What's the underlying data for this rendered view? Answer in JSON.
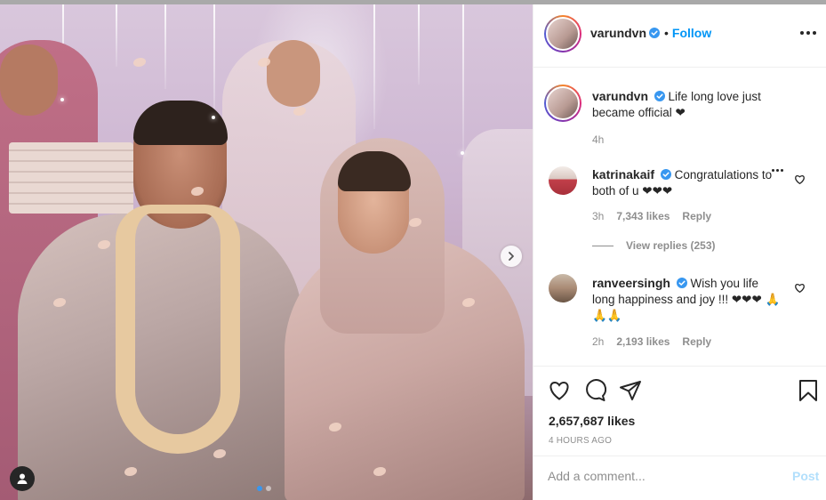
{
  "post": {
    "author": "varundvn",
    "follow_label": "Follow",
    "caption": "Life long love just became official ❤",
    "caption_time": "4h",
    "likes": "2,657,687 likes",
    "posted_ago": "4 HOURS AGO",
    "carousel": {
      "count": 2,
      "active": 1
    }
  },
  "comments": [
    {
      "user": "katrinakaif",
      "text": "Congratulations to both of u ❤❤❤",
      "time": "3h",
      "likes": "7,343 likes",
      "reply": "Reply",
      "view_replies": "View replies (253)"
    },
    {
      "user": "ranveersingh",
      "text": "Wish you life long happiness and joy !!! ❤❤❤ 🙏 🙏🙏",
      "time": "2h",
      "likes": "2,193 likes",
      "reply": "Reply"
    }
  ],
  "composer": {
    "placeholder": "Add a comment...",
    "post_label": "Post"
  },
  "colors": {
    "link_blue": "#0095f6",
    "verified_blue": "#3897f0",
    "muted": "#8e8e8e",
    "post_disabled": "#b2dffc"
  },
  "icons": [
    "more-icon",
    "verified-icon",
    "heart-icon",
    "comment-icon",
    "share-icon",
    "bookmark-icon",
    "next-arrow-icon",
    "user-tag-icon"
  ]
}
